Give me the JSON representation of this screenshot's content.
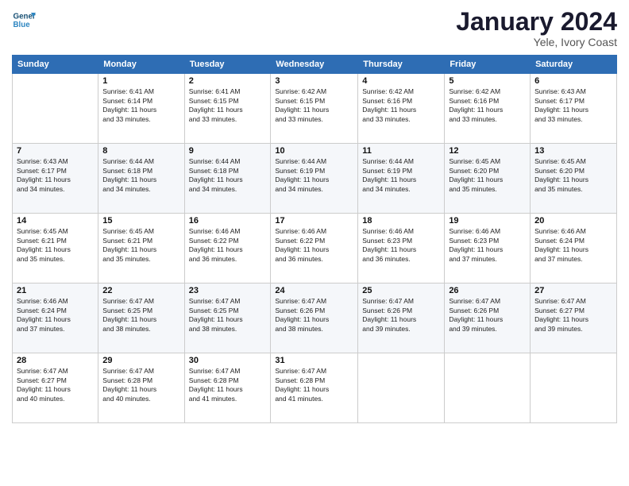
{
  "logo": {
    "line1": "General",
    "line2": "Blue"
  },
  "title": "January 2024",
  "subtitle": "Yele, Ivory Coast",
  "header_days": [
    "Sunday",
    "Monday",
    "Tuesday",
    "Wednesday",
    "Thursday",
    "Friday",
    "Saturday"
  ],
  "weeks": [
    [
      {
        "num": "",
        "info": ""
      },
      {
        "num": "1",
        "info": "Sunrise: 6:41 AM\nSunset: 6:14 PM\nDaylight: 11 hours\nand 33 minutes."
      },
      {
        "num": "2",
        "info": "Sunrise: 6:41 AM\nSunset: 6:15 PM\nDaylight: 11 hours\nand 33 minutes."
      },
      {
        "num": "3",
        "info": "Sunrise: 6:42 AM\nSunset: 6:15 PM\nDaylight: 11 hours\nand 33 minutes."
      },
      {
        "num": "4",
        "info": "Sunrise: 6:42 AM\nSunset: 6:16 PM\nDaylight: 11 hours\nand 33 minutes."
      },
      {
        "num": "5",
        "info": "Sunrise: 6:42 AM\nSunset: 6:16 PM\nDaylight: 11 hours\nand 33 minutes."
      },
      {
        "num": "6",
        "info": "Sunrise: 6:43 AM\nSunset: 6:17 PM\nDaylight: 11 hours\nand 33 minutes."
      }
    ],
    [
      {
        "num": "7",
        "info": "Sunrise: 6:43 AM\nSunset: 6:17 PM\nDaylight: 11 hours\nand 34 minutes."
      },
      {
        "num": "8",
        "info": "Sunrise: 6:44 AM\nSunset: 6:18 PM\nDaylight: 11 hours\nand 34 minutes."
      },
      {
        "num": "9",
        "info": "Sunrise: 6:44 AM\nSunset: 6:18 PM\nDaylight: 11 hours\nand 34 minutes."
      },
      {
        "num": "10",
        "info": "Sunrise: 6:44 AM\nSunset: 6:19 PM\nDaylight: 11 hours\nand 34 minutes."
      },
      {
        "num": "11",
        "info": "Sunrise: 6:44 AM\nSunset: 6:19 PM\nDaylight: 11 hours\nand 34 minutes."
      },
      {
        "num": "12",
        "info": "Sunrise: 6:45 AM\nSunset: 6:20 PM\nDaylight: 11 hours\nand 35 minutes."
      },
      {
        "num": "13",
        "info": "Sunrise: 6:45 AM\nSunset: 6:20 PM\nDaylight: 11 hours\nand 35 minutes."
      }
    ],
    [
      {
        "num": "14",
        "info": "Sunrise: 6:45 AM\nSunset: 6:21 PM\nDaylight: 11 hours\nand 35 minutes."
      },
      {
        "num": "15",
        "info": "Sunrise: 6:45 AM\nSunset: 6:21 PM\nDaylight: 11 hours\nand 35 minutes."
      },
      {
        "num": "16",
        "info": "Sunrise: 6:46 AM\nSunset: 6:22 PM\nDaylight: 11 hours\nand 36 minutes."
      },
      {
        "num": "17",
        "info": "Sunrise: 6:46 AM\nSunset: 6:22 PM\nDaylight: 11 hours\nand 36 minutes."
      },
      {
        "num": "18",
        "info": "Sunrise: 6:46 AM\nSunset: 6:23 PM\nDaylight: 11 hours\nand 36 minutes."
      },
      {
        "num": "19",
        "info": "Sunrise: 6:46 AM\nSunset: 6:23 PM\nDaylight: 11 hours\nand 37 minutes."
      },
      {
        "num": "20",
        "info": "Sunrise: 6:46 AM\nSunset: 6:24 PM\nDaylight: 11 hours\nand 37 minutes."
      }
    ],
    [
      {
        "num": "21",
        "info": "Sunrise: 6:46 AM\nSunset: 6:24 PM\nDaylight: 11 hours\nand 37 minutes."
      },
      {
        "num": "22",
        "info": "Sunrise: 6:47 AM\nSunset: 6:25 PM\nDaylight: 11 hours\nand 38 minutes."
      },
      {
        "num": "23",
        "info": "Sunrise: 6:47 AM\nSunset: 6:25 PM\nDaylight: 11 hours\nand 38 minutes."
      },
      {
        "num": "24",
        "info": "Sunrise: 6:47 AM\nSunset: 6:26 PM\nDaylight: 11 hours\nand 38 minutes."
      },
      {
        "num": "25",
        "info": "Sunrise: 6:47 AM\nSunset: 6:26 PM\nDaylight: 11 hours\nand 39 minutes."
      },
      {
        "num": "26",
        "info": "Sunrise: 6:47 AM\nSunset: 6:26 PM\nDaylight: 11 hours\nand 39 minutes."
      },
      {
        "num": "27",
        "info": "Sunrise: 6:47 AM\nSunset: 6:27 PM\nDaylight: 11 hours\nand 39 minutes."
      }
    ],
    [
      {
        "num": "28",
        "info": "Sunrise: 6:47 AM\nSunset: 6:27 PM\nDaylight: 11 hours\nand 40 minutes."
      },
      {
        "num": "29",
        "info": "Sunrise: 6:47 AM\nSunset: 6:28 PM\nDaylight: 11 hours\nand 40 minutes."
      },
      {
        "num": "30",
        "info": "Sunrise: 6:47 AM\nSunset: 6:28 PM\nDaylight: 11 hours\nand 41 minutes."
      },
      {
        "num": "31",
        "info": "Sunrise: 6:47 AM\nSunset: 6:28 PM\nDaylight: 11 hours\nand 41 minutes."
      },
      {
        "num": "",
        "info": ""
      },
      {
        "num": "",
        "info": ""
      },
      {
        "num": "",
        "info": ""
      }
    ]
  ]
}
